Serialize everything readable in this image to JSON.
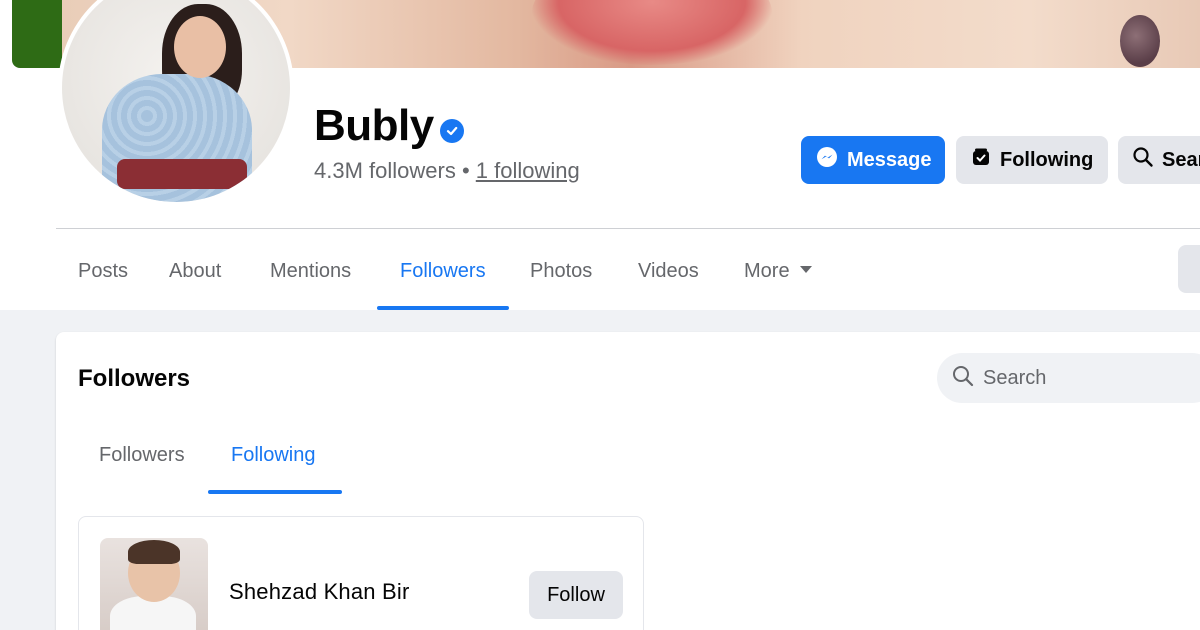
{
  "profile": {
    "name": "Bubly",
    "followers_text": "4.3M followers",
    "separator": " • ",
    "following_text": "1 following"
  },
  "actions": {
    "message_label": "Message",
    "following_label": "Following",
    "search_label": "Sear"
  },
  "tabs": [
    {
      "label": "Posts",
      "active": false
    },
    {
      "label": "About",
      "active": false
    },
    {
      "label": "Mentions",
      "active": false
    },
    {
      "label": "Followers",
      "active": true
    },
    {
      "label": "Photos",
      "active": false
    },
    {
      "label": "Videos",
      "active": false
    },
    {
      "label": "More",
      "active": false
    }
  ],
  "followers_section": {
    "title": "Followers",
    "search_placeholder": "Search",
    "subtabs": [
      {
        "label": "Followers",
        "active": false
      },
      {
        "label": "Following",
        "active": true
      }
    ],
    "people": [
      {
        "name": "Shehzad Khan Bir",
        "button_label": "Follow"
      }
    ]
  },
  "colors": {
    "accent": "#1877f2",
    "muted_text": "#65676b",
    "button_gray": "#e4e6eb",
    "page_bg": "#f0f2f5"
  },
  "icons": {
    "verified": "verified-badge-icon",
    "message": "messenger-icon",
    "following": "following-check-icon",
    "search": "search-icon",
    "more": "caret-down-icon"
  }
}
